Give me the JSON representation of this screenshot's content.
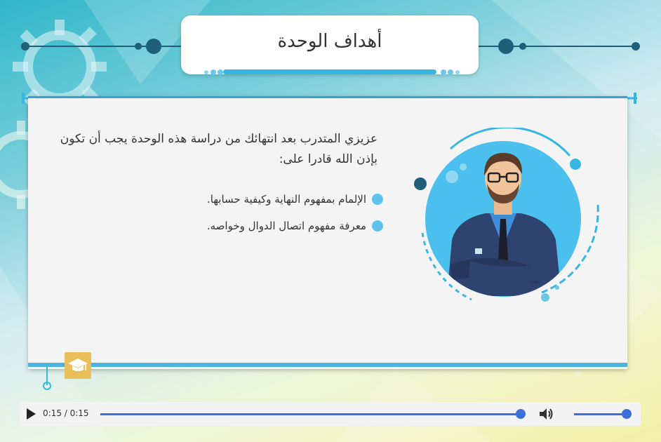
{
  "slide": {
    "title": "أهداف الوحدة",
    "intro": "عزيزي المتدرب بعد انتهائك من دراسة هذه الوحدة يجب أن تكون بإذن الله قادرا على:",
    "objectives": [
      "الإلمام بمفهوم النهاية وكيفية حسابها.",
      "معرفة مفهوم اتصال الدوال وخواصه."
    ]
  },
  "player": {
    "time": "0:15 / 0:15",
    "progress": 1.0,
    "volume": 1.0
  },
  "colors": {
    "accent": "#37b6e2",
    "dark_node": "#1f5f7a",
    "player_blue": "#3b6fd8",
    "badge": "#e9bf5a"
  },
  "icons": {
    "play": "play-icon",
    "volume": "volume-icon",
    "badge": "graduation-cap-icon",
    "avatar": "teacher-avatar-icon"
  }
}
